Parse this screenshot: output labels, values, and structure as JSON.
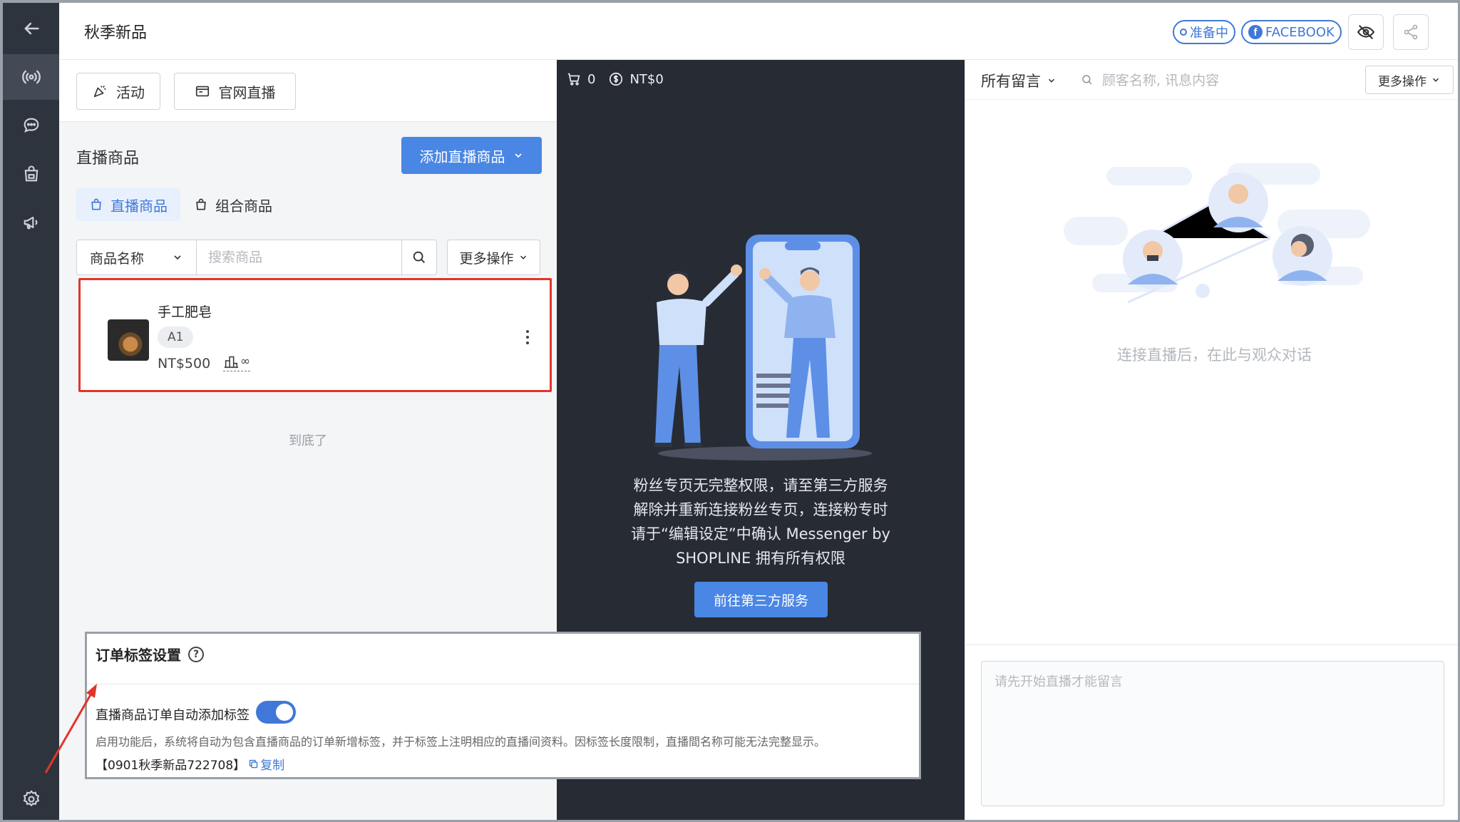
{
  "header": {
    "title": "秋季新品",
    "status_label": "准备中",
    "platform_label": "FACEBOOK"
  },
  "left_panel": {
    "activity_button": "活动",
    "website_live_button": "官网直播",
    "section_title": "直播商品",
    "add_product_button": "添加直播商品",
    "tabs": [
      {
        "label": "直播商品",
        "active": true
      },
      {
        "label": "组合商品",
        "active": false
      }
    ],
    "search": {
      "field_select": "商品名称",
      "placeholder": "搜索商品",
      "more_actions": "更多操作"
    },
    "products": [
      {
        "name": "手工肥皂",
        "tag": "A1",
        "price": "NT$500",
        "stock": "∞"
      }
    ],
    "end_text": "到底了"
  },
  "center_panel": {
    "cart_count": "0",
    "total": "NT$0",
    "notice_lines": [
      "粉丝专页无完整权限，请至第三方服务",
      "解除并重新连接粉丝专页，连接粉专时",
      "请于“编辑设定”中确认 Messenger by",
      "SHOPLINE 拥有所有权限"
    ],
    "cta_label": "前往第三方服务"
  },
  "right_panel": {
    "filter_label": "所有留言",
    "search_placeholder": "顾客名称, 讯息内容",
    "more_actions": "更多操作",
    "empty_hint": "连接直播后，在此与观众对话",
    "comment_placeholder": "请先开始直播才能留言"
  },
  "tag_settings": {
    "title": "订单标签设置",
    "toggle_label": "直播商品订单自动添加标签",
    "toggle_on": true,
    "description": "启用功能后，系统将自动为包含直播商品的订单新增标签，并于标签上注明相应的直播间资料。因标签长度限制，直播間名称可能无法完整显示。",
    "tag_code": "【0901秋季新品722708】",
    "copy_label": "复制"
  },
  "colors": {
    "accent": "#4a86e4",
    "rail": "#2e343d",
    "center_bg": "#272b33",
    "highlight_red": "#e2352a"
  }
}
